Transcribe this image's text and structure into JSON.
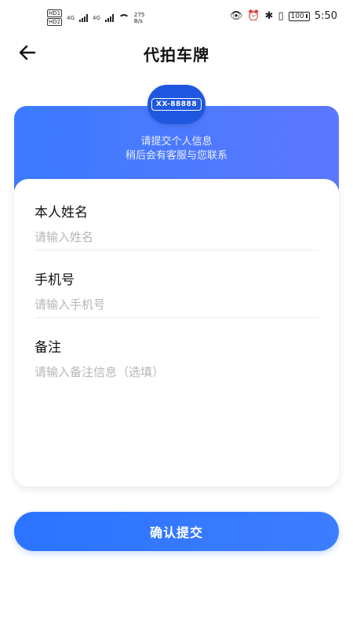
{
  "status_bar": {
    "hd1": "HD",
    "hd2": "HD",
    "sim1": "1",
    "sim2": "2",
    "net1": "4G",
    "net2": "4G",
    "speed_value": "275",
    "speed_unit": "B/s",
    "battery": "100",
    "time": "5:50"
  },
  "header": {
    "title": "代拍车牌",
    "back_icon": "back-arrow-icon"
  },
  "hero": {
    "plate_text": "XX-88888",
    "line1": "请提交个人信息",
    "line2": "稍后会有客服与您联系"
  },
  "form": {
    "name": {
      "label": "本人姓名",
      "placeholder": "请输入姓名",
      "value": ""
    },
    "phone": {
      "label": "手机号",
      "placeholder": "请输入手机号",
      "value": ""
    },
    "note": {
      "label": "备注",
      "placeholder": "请输入备注信息（选填）",
      "value": ""
    }
  },
  "submit": {
    "label": "确认提交"
  },
  "colors": {
    "primary": "#2b74ff",
    "hero_start": "#3b7bff",
    "hero_end": "#5c78ff",
    "plate_bg": "#1f57e0"
  }
}
